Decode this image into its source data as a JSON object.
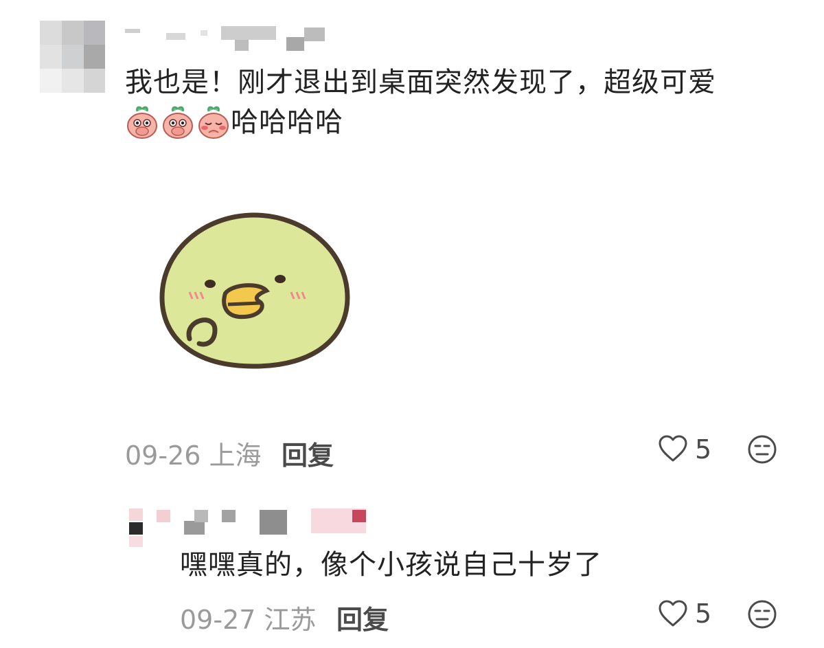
{
  "comments": [
    {
      "text_line1": "我也是！刚才退出到桌面突然发现了，超级可爱",
      "text_line2_suffix": "哈哈哈哈",
      "emojis": [
        "peach-cover-mouth-icon",
        "peach-cover-mouth-icon",
        "peach-shy-icon"
      ],
      "sticker": "green-chick-sticker",
      "date": "09-26",
      "location": "上海",
      "reply_label": "回复",
      "likes": "5"
    },
    {
      "text": "嘿嘿真的，像个小孩说自己十岁了",
      "date": "09-27",
      "location": "江苏",
      "reply_label": "回复",
      "likes": "5"
    }
  ],
  "colors": {
    "text": "#222222",
    "meta": "#9a9a9a",
    "sticker_fill": "#dde79a",
    "sticker_outline": "#4a3b2c",
    "beak": "#f2c94c"
  }
}
